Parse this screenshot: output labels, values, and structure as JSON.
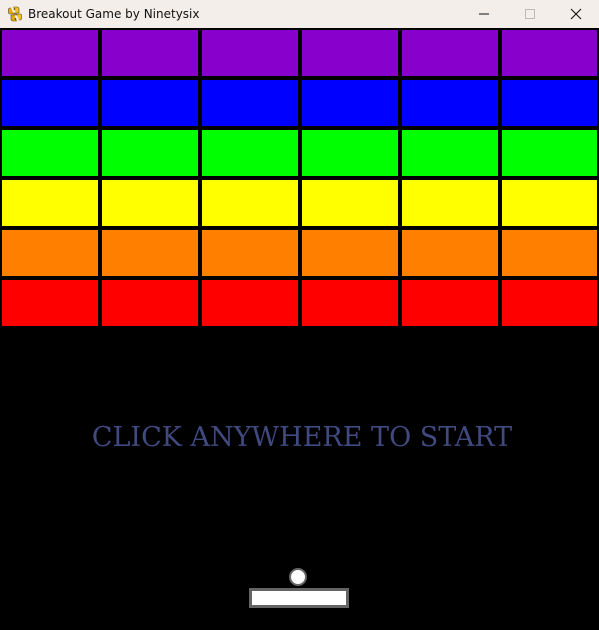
{
  "window": {
    "title": "Breakout Game by Ninetysix",
    "icon": "python-icon",
    "controls": [
      "minimize-icon",
      "maximize-icon",
      "close-icon"
    ]
  },
  "game": {
    "message": "CLICK ANYWHERE TO START",
    "message_color": "#404a80",
    "background_color": "#000000",
    "brick_rows": [
      {
        "color": "#8800cc",
        "count": 6
      },
      {
        "color": "#0000ff",
        "count": 6
      },
      {
        "color": "#00ff00",
        "count": 6
      },
      {
        "color": "#ffff00",
        "count": 6
      },
      {
        "color": "#ff8000",
        "count": 6
      },
      {
        "color": "#ff0000",
        "count": 6
      }
    ],
    "ball_color": "#ffffff",
    "paddle_color": "#ffffff",
    "outline_color": "#646464"
  }
}
